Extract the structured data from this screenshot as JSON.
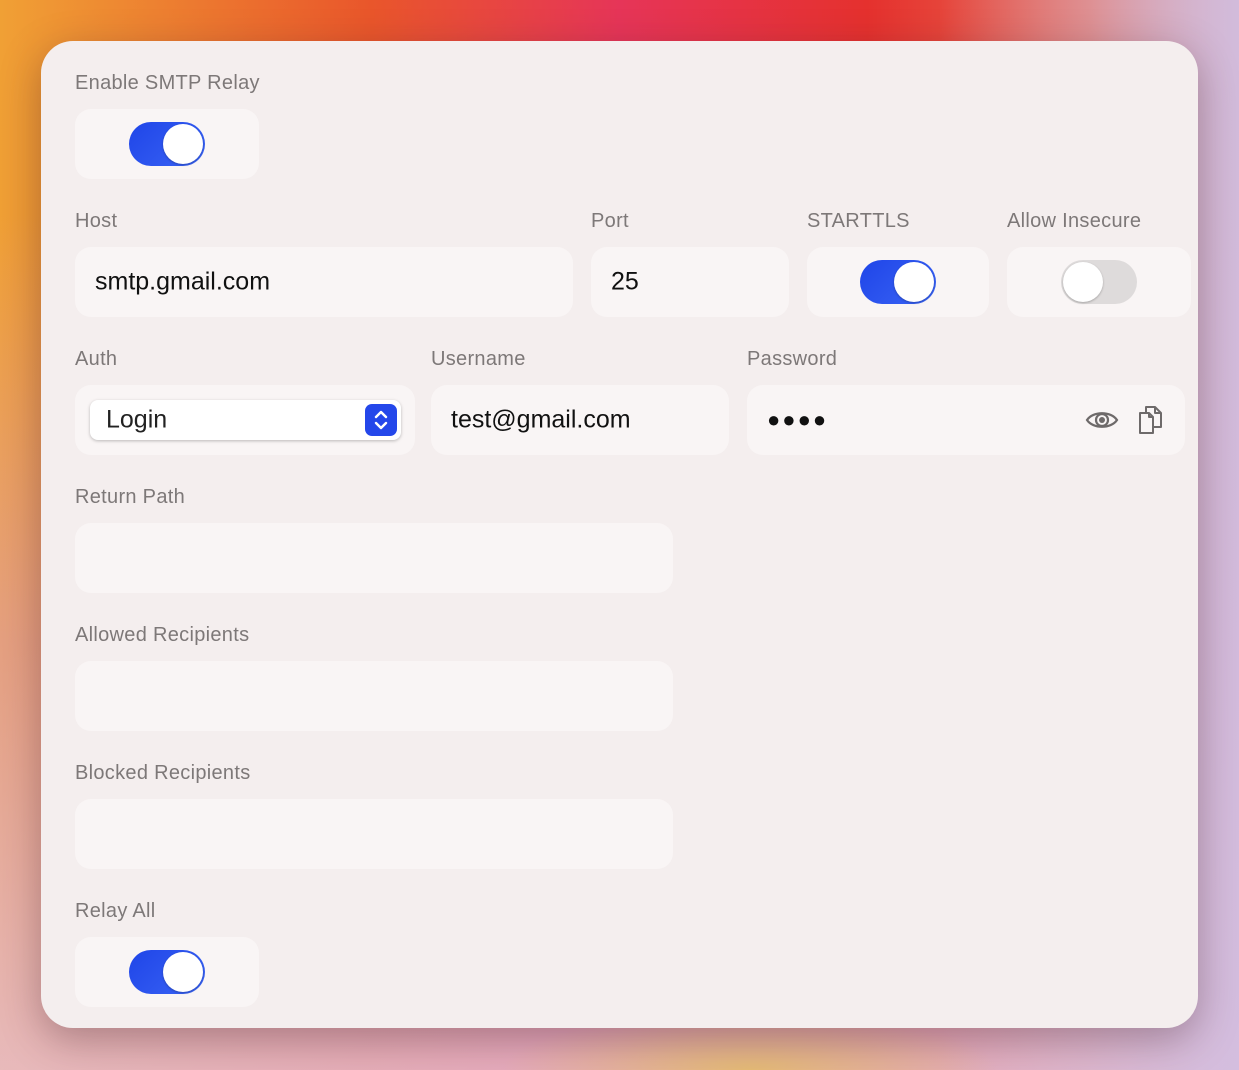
{
  "form": {
    "enable_smtp_relay": {
      "label": "Enable SMTP Relay",
      "on": true
    },
    "host": {
      "label": "Host",
      "value": "smtp.gmail.com"
    },
    "port": {
      "label": "Port",
      "value": "25"
    },
    "starttls": {
      "label": "STARTTLS",
      "on": true
    },
    "allow_insecure": {
      "label": "Allow Insecure",
      "on": false
    },
    "auth": {
      "label": "Auth",
      "selected": "Login",
      "icon": "chevron-up-down-icon"
    },
    "username": {
      "label": "Username",
      "value": "test@gmail.com"
    },
    "password": {
      "label": "Password",
      "masked_value": "●●●●",
      "icons": [
        "eye-icon",
        "copy-icon"
      ]
    },
    "return_path": {
      "label": "Return Path",
      "value": ""
    },
    "allowed_recipients": {
      "label": "Allowed Recipients",
      "value": ""
    },
    "blocked_recipients": {
      "label": "Blocked Recipients",
      "value": ""
    },
    "relay_all": {
      "label": "Relay All",
      "on": true
    }
  },
  "colors": {
    "accent": "#2447ea",
    "toggle_off": "#dedbdb",
    "panel": "#f4eeee",
    "field": "#f9f5f5",
    "label": "#7d7878"
  }
}
